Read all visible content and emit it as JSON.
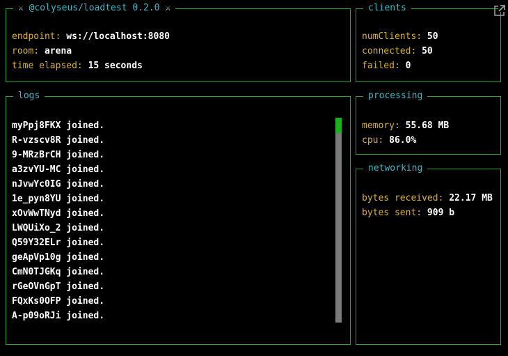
{
  "header": {
    "title": "@colyseus/loadtest 0.2.0",
    "icon_left": "crossed-swords-icon",
    "icon_right": "crossed-swords-icon"
  },
  "main": {
    "endpoint_label": "endpoint:",
    "endpoint_value": "ws://localhost:8080",
    "room_label": "room:",
    "room_value": "arena",
    "time_label": "time elapsed:",
    "time_value": "15 seconds"
  },
  "clients": {
    "title": "clients",
    "num_label": "numClients:",
    "num_value": "50",
    "connected_label": "connected:",
    "connected_value": "50",
    "failed_label": "failed:",
    "failed_value": "0"
  },
  "logs": {
    "title": "logs",
    "lines": [
      "myPpj8FKX joined.",
      "R-vzscv8R joined.",
      "9-MRzBrCH joined.",
      "a3zvYU-MC joined.",
      "nJvwYc0IG joined.",
      "1e_pyn8YU joined.",
      "xOvWwTNyd joined.",
      "LWQUiXo_2 joined.",
      "Q59Y32ELr joined.",
      "geApVp10g joined.",
      "CmN0TJGKq joined.",
      "rGeOVnGpT joined.",
      "FQxKs0OFP joined.",
      "A-p09oRJi joined."
    ]
  },
  "processing": {
    "title": "processing",
    "memory_label": "memory:",
    "memory_value": "55.68 MB",
    "cpu_label": "cpu:",
    "cpu_value": "86.0%"
  },
  "networking": {
    "title": "networking",
    "received_label": "bytes received:",
    "received_value": "22.17 MB",
    "sent_label": "bytes sent:",
    "sent_value": "909 b"
  },
  "colors": {
    "border": "#2ea62e",
    "title": "#3fb8c8",
    "key": "#d8b13a",
    "value": "#ffffff",
    "scroll_thumb": "#1fae1f",
    "scroll_track": "#7a7a7a"
  },
  "window": {
    "popout_icon": "popout-icon"
  }
}
